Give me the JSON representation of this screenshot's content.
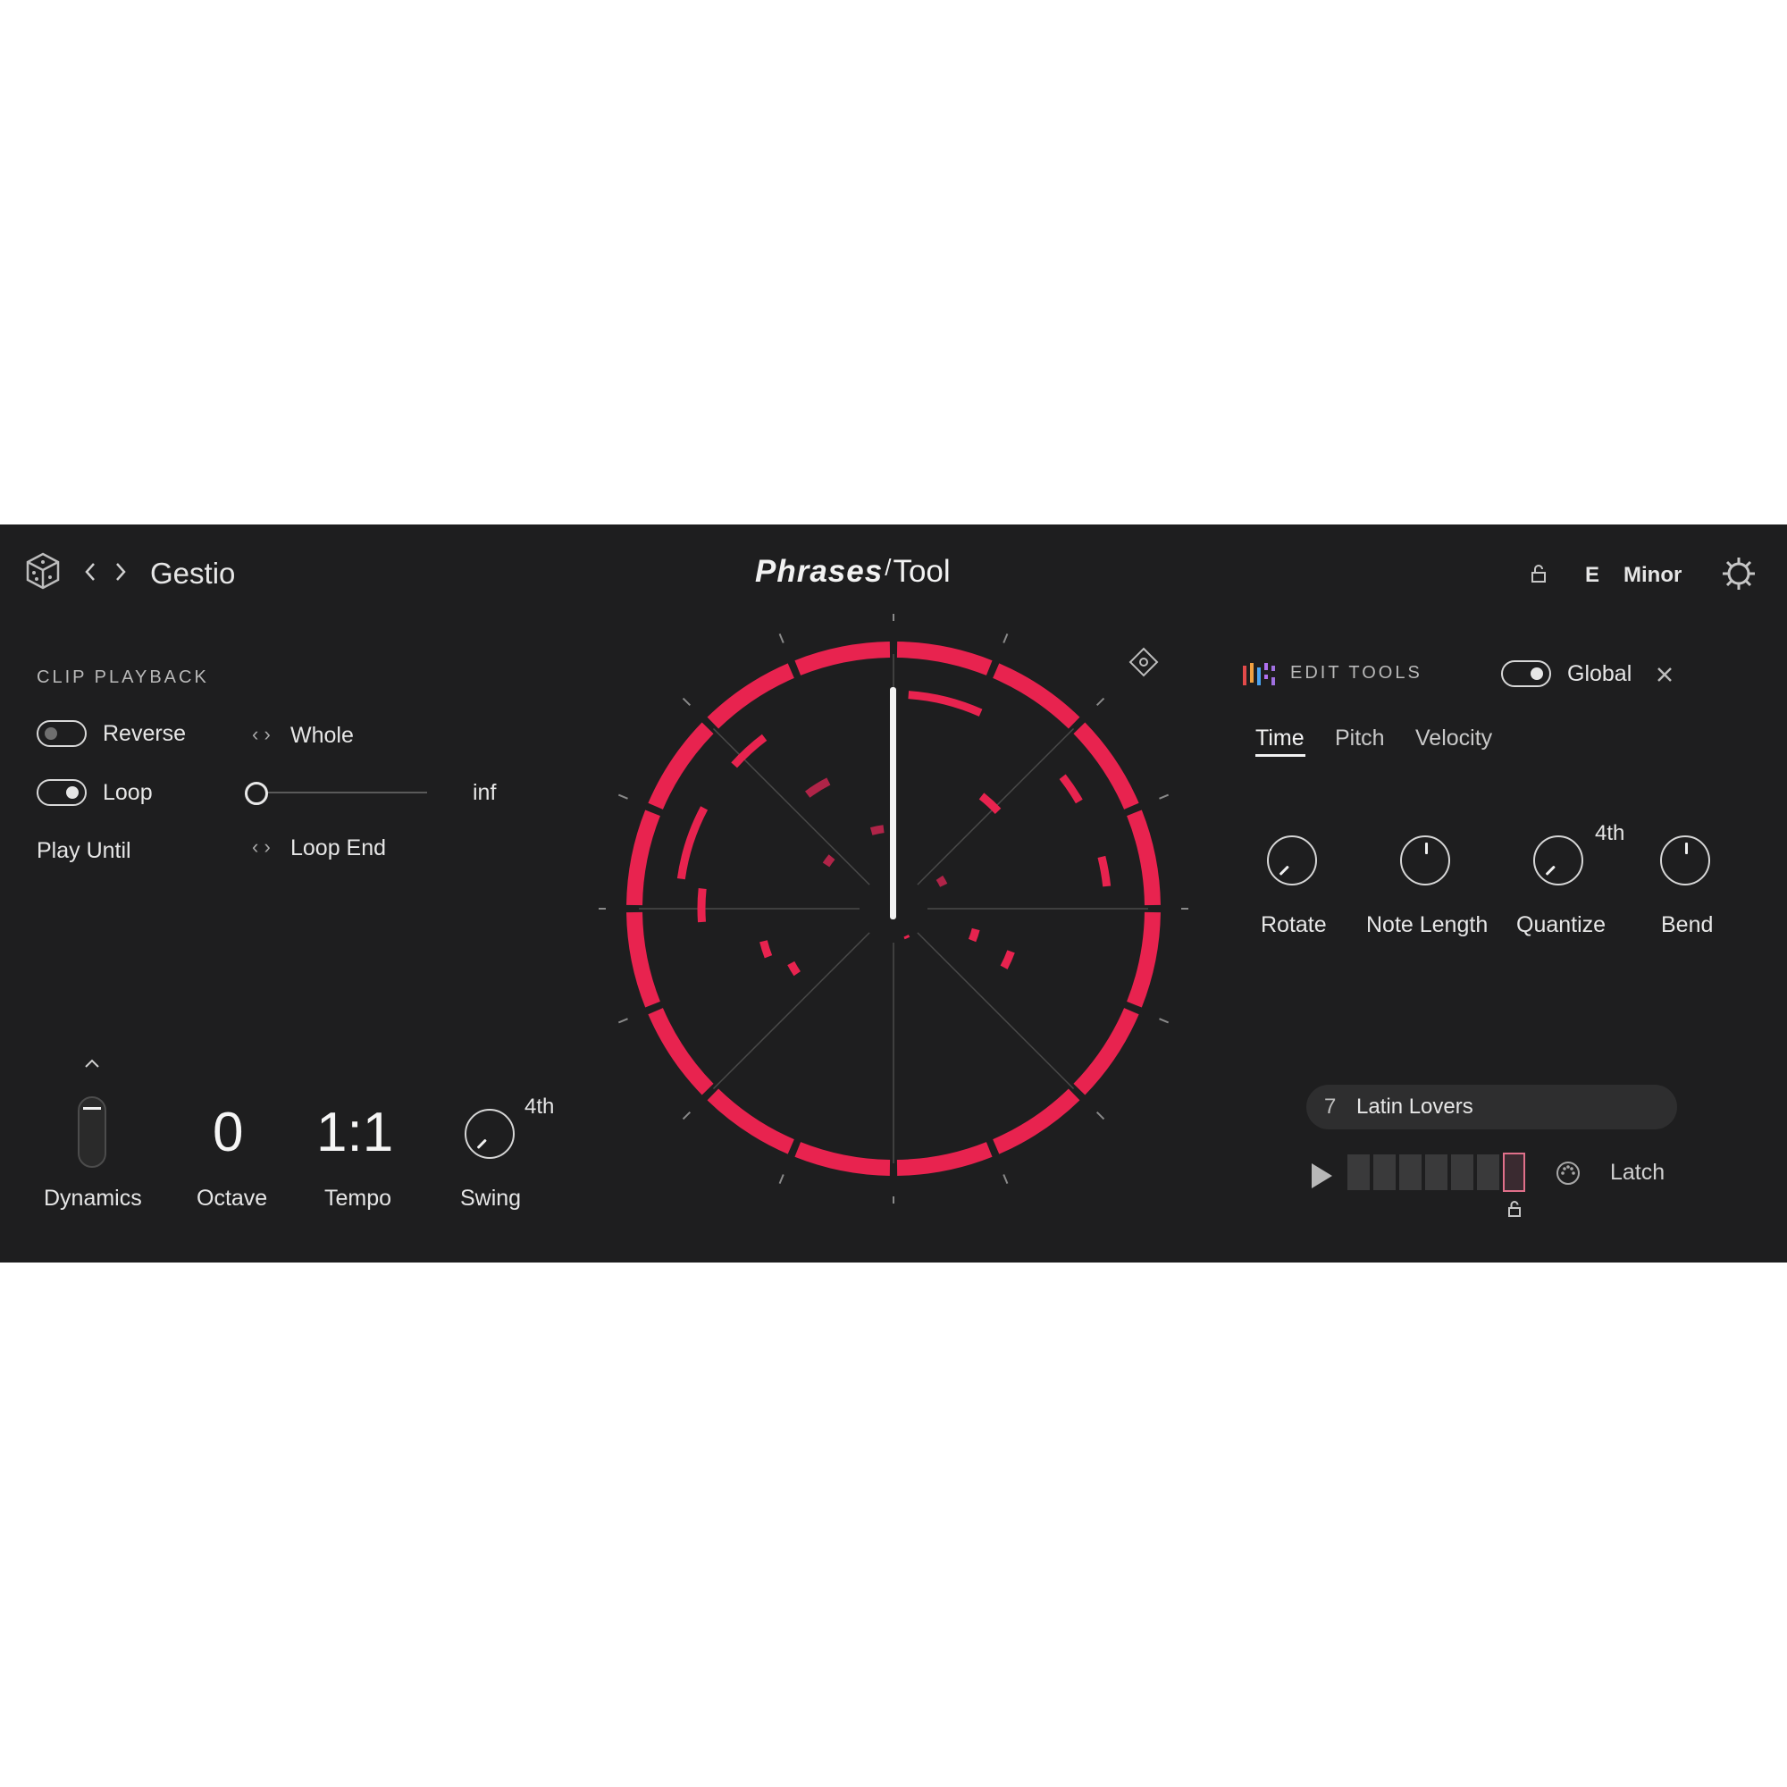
{
  "header": {
    "preset_name": "Gestio",
    "brand_main": "Phrases",
    "brand_sub": "Tool",
    "key": "E",
    "scale": "Minor",
    "icons": [
      "dice-icon",
      "chevron-left-icon",
      "chevron-right-icon",
      "lock-icon",
      "gear-icon"
    ]
  },
  "clip_playback": {
    "title": "CLIP PLAYBACK",
    "reverse_label": "Reverse",
    "reverse_on": false,
    "loop_label": "Loop",
    "loop_on": true,
    "range_value": "Whole",
    "loop_slider_end": "inf",
    "play_until_label": "Play Until",
    "play_until_value": "Loop End"
  },
  "bottom_controls": {
    "dynamics_label": "Dynamics",
    "octave_value": "0",
    "octave_label": "Octave",
    "tempo_value": "1:1",
    "tempo_label": "Tempo",
    "swing_value": "4th",
    "swing_label": "Swing"
  },
  "edit_tools": {
    "title": "EDIT TOOLS",
    "global_label": "Global",
    "global_on": true,
    "tabs": [
      "Time",
      "Pitch",
      "Velocity"
    ],
    "active_tab": "Time",
    "knobs": {
      "rotate": "Rotate",
      "note_length": "Note Length",
      "quantize": "Quantize",
      "quantize_value": "4th",
      "bend": "Bend"
    }
  },
  "pattern": {
    "number": "7",
    "name": "Latin Lovers",
    "latch_label": "Latch",
    "steps": 7,
    "selected_step": 7
  },
  "colors": {
    "background": "#1e1e1f",
    "accent": "#e8234f",
    "accent_dim": "#b02448",
    "text": "#e6e6e6"
  }
}
